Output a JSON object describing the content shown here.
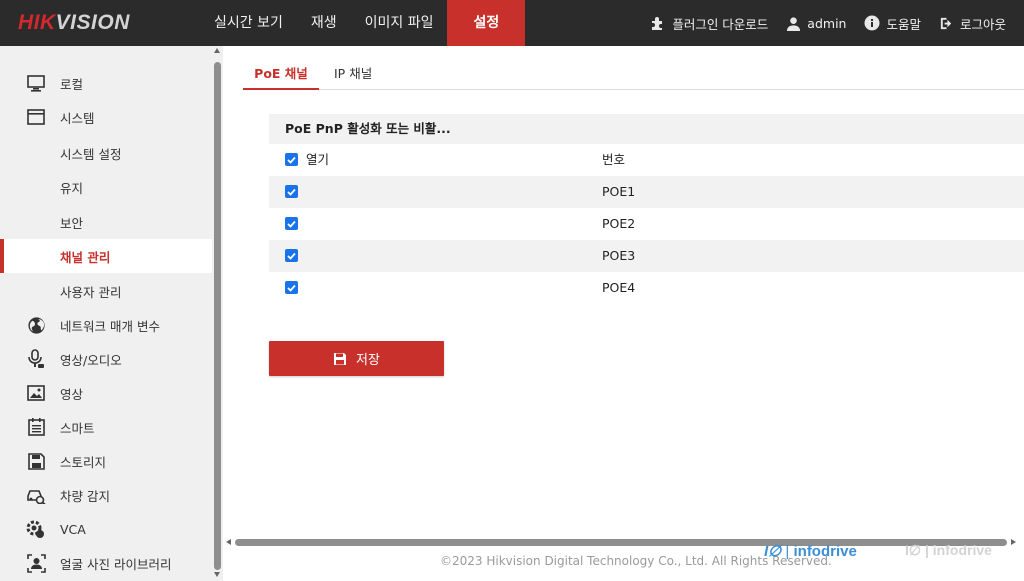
{
  "brand": {
    "part1": "HIK",
    "part2": "VISION"
  },
  "nav": [
    {
      "label": "실시간 보기",
      "active": false
    },
    {
      "label": "재생",
      "active": false
    },
    {
      "label": "이미지 파일",
      "active": false
    },
    {
      "label": "설정",
      "active": true
    }
  ],
  "top_right": {
    "plugin": "플러그인 다운로드",
    "user": "admin",
    "help": "도움말",
    "logout": "로그아웃"
  },
  "sidebar": {
    "items": [
      {
        "label": "로컬",
        "icon": "monitor-icon"
      },
      {
        "label": "시스템",
        "icon": "window-icon"
      },
      {
        "label": "시스템 설정",
        "sub": true
      },
      {
        "label": "유지",
        "sub": true
      },
      {
        "label": "보안",
        "sub": true
      },
      {
        "label": "채널 관리",
        "sub": true,
        "active": true
      },
      {
        "label": "사용자 관리",
        "sub": true
      },
      {
        "label": "네트워크 매개 변수",
        "icon": "globe-icon"
      },
      {
        "label": "영상/오디오",
        "icon": "microphone-icon"
      },
      {
        "label": "영상",
        "icon": "image-icon"
      },
      {
        "label": "스마트",
        "icon": "calendar-list-icon"
      },
      {
        "label": "스토리지",
        "icon": "floppy-icon"
      },
      {
        "label": "차량 감지",
        "icon": "car-search-icon"
      },
      {
        "label": "VCA",
        "icon": "vca-gear-icon"
      },
      {
        "label": "얼굴 사진 라이브러리",
        "icon": "face-frame-icon"
      }
    ]
  },
  "tabs": [
    {
      "label": "PoE 채널",
      "active": true
    },
    {
      "label": "IP 채널",
      "active": false
    }
  ],
  "poe_table": {
    "header": "PoE PnP 활성화 또는 비활...",
    "col_enable": "열기",
    "col_number": "번호",
    "rows": [
      {
        "number": "POE1",
        "checked": true
      },
      {
        "number": "POE2",
        "checked": true
      },
      {
        "number": "POE3",
        "checked": true
      },
      {
        "number": "POE4",
        "checked": true
      }
    ]
  },
  "save_label": "저장",
  "footer": "©2023 Hikvision Digital Technology Co., Ltd. All Rights Reserved.",
  "watermark": {
    "mark": "I∅",
    "sep": "|",
    "text": "infodrive"
  },
  "colors": {
    "accent": "#c8302b",
    "topbar": "#2b2b2b",
    "checkbox": "#1a73e8"
  }
}
